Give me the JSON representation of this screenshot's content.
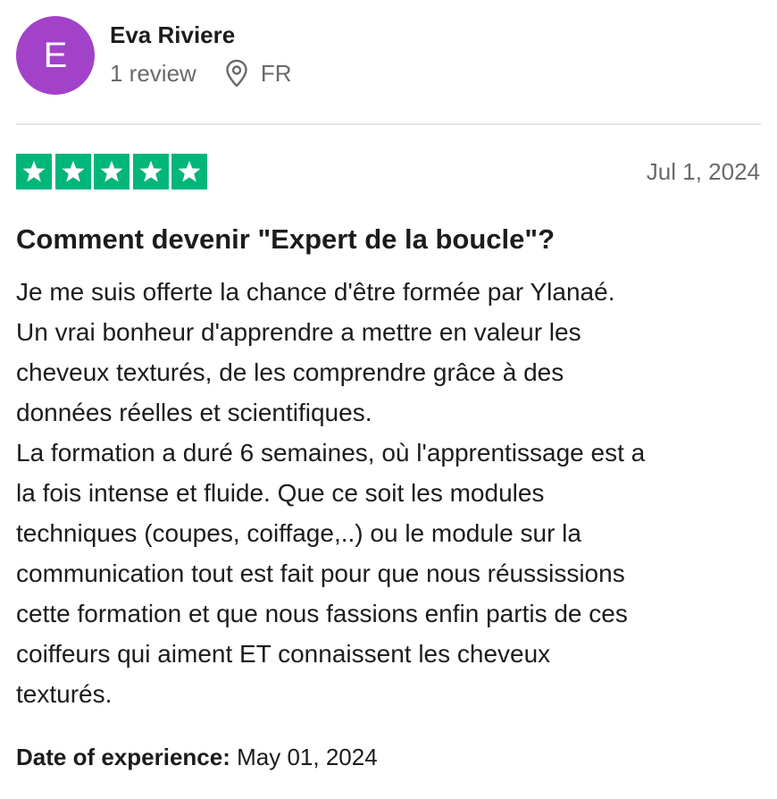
{
  "reviewer": {
    "initial": "E",
    "name": "Eva Riviere",
    "review_count": "1 review",
    "country": "FR",
    "avatar_color": "#a142c8"
  },
  "location_icon": "map-pin-icon",
  "rating": {
    "stars": 5,
    "max": 5,
    "color": "#00b67a",
    "icon": "star-icon"
  },
  "review": {
    "date": "Jul 1, 2024",
    "title": "Comment devenir \"Expert de la boucle\"?",
    "body_lines": [
      "Je me suis offerte la chance d'être formée par Ylanaé.",
      "Un vrai bonheur d'apprendre a mettre en valeur les",
      "cheveux texturés, de les comprendre grâce à des",
      "données réelles et scientifiques.",
      "La formation a duré 6 semaines, où l'apprentissage est a",
      "la fois intense et fluide. Que ce soit les modules",
      "techniques (coupes, coiffage,..) ou le module sur la",
      "communication tout est fait pour que nous réussissions",
      "cette formation et que nous fassions enfin partis de ces",
      "coiffeurs qui aiment ET connaissent les cheveux",
      "texturés."
    ]
  },
  "experience": {
    "label": "Date of experience:",
    "date": "May 01, 2024"
  }
}
